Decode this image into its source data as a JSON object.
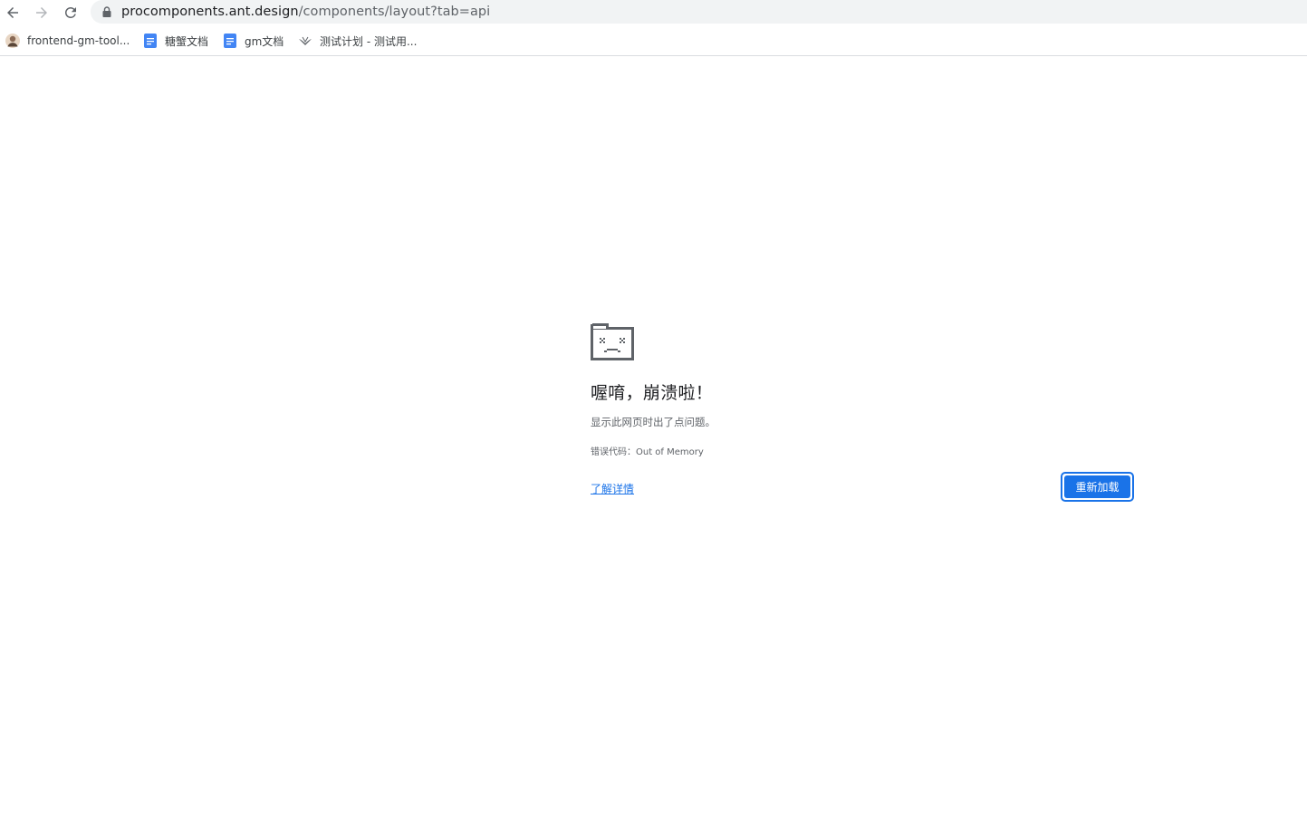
{
  "browser": {
    "url_host": "procomponents.ant.design",
    "url_path": "/components/layout?tab=api",
    "nav": {
      "back_icon": "arrow-left-icon",
      "forward_icon": "arrow-right-icon",
      "reload_icon": "reload-icon",
      "lock_icon": "lock-icon"
    }
  },
  "bookmarks": [
    {
      "label": "frontend-gm-tool...",
      "icon": "avatar-icon"
    },
    {
      "label": "糖蟹文档",
      "icon": "doc-icon"
    },
    {
      "label": "gm文档",
      "icon": "doc-icon"
    },
    {
      "label": "测试计划 - 测试用...",
      "icon": "bird-icon"
    }
  ],
  "error_page": {
    "icon": "sad-folder-icon",
    "heading": "喔唷，崩溃啦！",
    "suggestion": "显示此网页时出了点问题。",
    "error_code": "错误代码：Out of Memory",
    "learn_more": "了解详情",
    "reload_button": "重新加载"
  },
  "colors": {
    "accent": "#1a73e8",
    "omnibox_bg": "#f1f3f4",
    "text_primary": "#202124",
    "text_secondary": "#5f6368"
  }
}
